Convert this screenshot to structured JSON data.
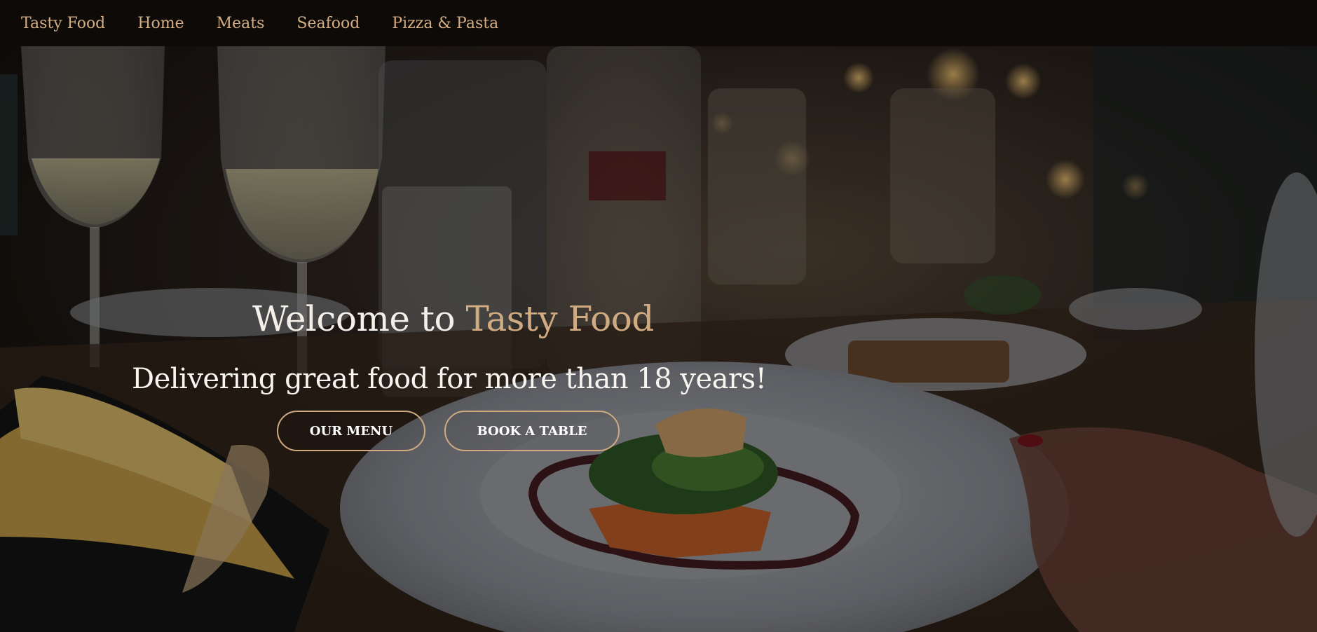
{
  "nav": {
    "brand": "Tasty Food",
    "items": [
      {
        "label": "Home"
      },
      {
        "label": "Meats"
      },
      {
        "label": "Seafood"
      },
      {
        "label": "Pizza & Pasta"
      }
    ]
  },
  "hero": {
    "title_prefix": "Welcome to ",
    "title_accent": "Tasty Food",
    "subtitle": "Delivering great food for more than 18 years!",
    "buttons": {
      "menu": "OUR MENU",
      "book": "BOOK A TABLE"
    }
  },
  "colors": {
    "accent": "#d0ab82",
    "nav_bg": "#0d0a07"
  }
}
